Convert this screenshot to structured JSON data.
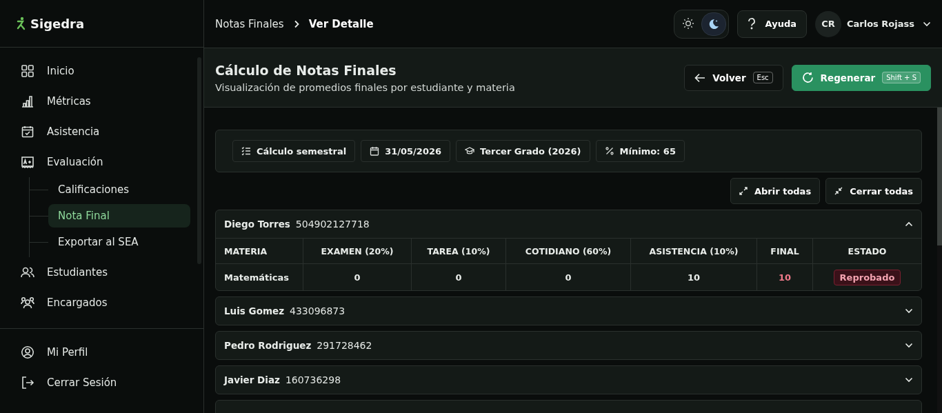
{
  "app": {
    "name": "Sigedra"
  },
  "sidebar": {
    "items": [
      {
        "label": "Inicio",
        "selected": false
      },
      {
        "label": "Métricas",
        "selected": false
      },
      {
        "label": "Asistencia",
        "selected": false
      },
      {
        "label": "Evaluación",
        "selected": false,
        "expanded": true,
        "children": [
          {
            "label": "Calificaciones",
            "selected": false
          },
          {
            "label": "Nota Final",
            "selected": true
          },
          {
            "label": "Exportar al SEA",
            "selected": false
          }
        ]
      },
      {
        "label": "Estudiantes",
        "selected": false
      },
      {
        "label": "Encargados",
        "selected": false
      }
    ],
    "footer": [
      {
        "label": "Mi Perfil"
      },
      {
        "label": "Cerrar Sesión"
      }
    ]
  },
  "breadcrumb": [
    "Notas Finales",
    "Ver Detalle"
  ],
  "topbar": {
    "theme_toggle": [
      {
        "selected": false
      },
      {
        "selected": true
      }
    ],
    "help": "Ayuda",
    "user": {
      "initials": "CR",
      "name": "Carlos Rojass"
    }
  },
  "page": {
    "title": "Cálculo de Notas Finales",
    "subtitle": "Visualización de promedios finales por estudiante y materia",
    "actions": [
      {
        "kind": "secondary",
        "label": "Volver",
        "shortcut": "Esc"
      },
      {
        "kind": "primary",
        "label": "Regenerar",
        "shortcut": "Shift + S"
      }
    ]
  },
  "filters": [
    {
      "label": "Cálculo semestral"
    },
    {
      "label": "31/05/2026"
    },
    {
      "label": "Tercer Grado (2026)"
    },
    {
      "label": "Mínimo: 65"
    }
  ],
  "toolbar": [
    {
      "label": "Abrir todas"
    },
    {
      "label": "Cerrar todas"
    }
  ],
  "table": {
    "columns": [
      "MATERIA",
      "EXAMEN (20%)",
      "TAREA (10%)",
      "COTIDIANO (60%)",
      "ASISTENCIA (10%)",
      "FINAL",
      "ESTADO"
    ]
  },
  "students": [
    {
      "name": "Diego Torres",
      "id": "504902127718",
      "expanded": true,
      "rows": [
        {
          "cells": [
            "Matemáticas",
            "0",
            "0",
            "0",
            "10",
            "10"
          ],
          "status": {
            "kind": "failed",
            "label": "Reprobado"
          }
        }
      ]
    },
    {
      "name": "Luis Gomez",
      "id": "433096873",
      "expanded": false
    },
    {
      "name": "Pedro Rodriguez",
      "id": "291728462",
      "expanded": false
    },
    {
      "name": "Javier Diaz",
      "id": "160736298",
      "expanded": false
    }
  ]
}
